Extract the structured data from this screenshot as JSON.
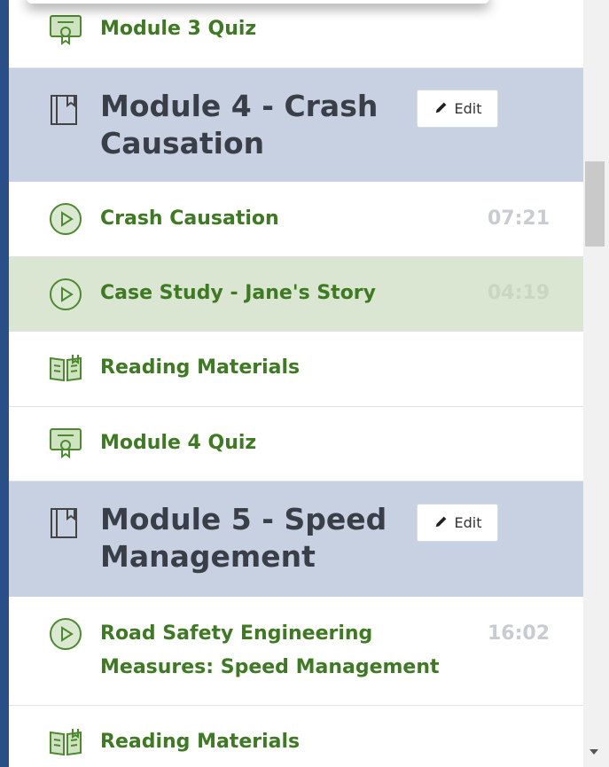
{
  "items": [
    {
      "type": "quiz",
      "label": "Module 3 Quiz"
    },
    {
      "type": "module",
      "title": "Module 4 - Crash Causation",
      "edit_label": "Edit"
    },
    {
      "type": "video",
      "label": "Crash Causation",
      "duration": "07:21"
    },
    {
      "type": "video",
      "label": "Case Study - Jane's Story",
      "duration": "04:19",
      "active": true
    },
    {
      "type": "reading",
      "label": "Reading Materials"
    },
    {
      "type": "quiz",
      "label": "Module 4 Quiz"
    },
    {
      "type": "module",
      "title": "Module 5 - Speed Management",
      "edit_label": "Edit"
    },
    {
      "type": "video",
      "label": "Road Safety Engineering Measures: Speed Management",
      "duration": "16:02"
    },
    {
      "type": "reading",
      "label": "Reading Materials"
    }
  ],
  "colors": {
    "module_bg": "#c8d1e2",
    "active_bg": "#dbe6d2",
    "link_green": "#3d7a22",
    "icon_green": "#4c8a2e"
  }
}
